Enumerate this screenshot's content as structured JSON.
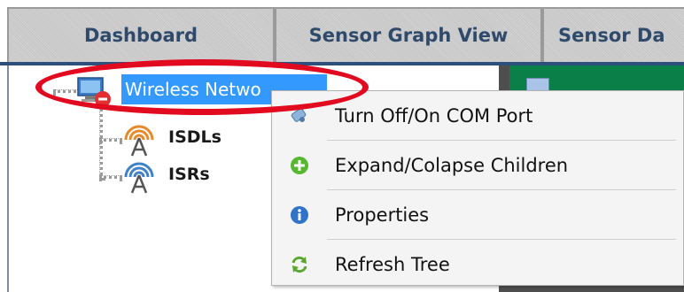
{
  "tabs": [
    {
      "label": "Dashboard"
    },
    {
      "label": "Sensor Graph View"
    },
    {
      "label": "Sensor Da"
    }
  ],
  "tree": {
    "root": {
      "label": "Wireless Netwo",
      "icon": "network-computer-icon"
    },
    "children": [
      {
        "label": "ISDLs",
        "icon": "antenna-orange-icon"
      },
      {
        "label": "ISRs",
        "icon": "antenna-blue-icon"
      }
    ]
  },
  "context_menu": {
    "items": [
      {
        "label": "Turn Off/On COM Port",
        "icon": "com-port-icon"
      },
      {
        "label": "Expand/Colapse Children",
        "icon": "plus-green-icon"
      },
      {
        "label": "Properties",
        "icon": "info-icon"
      },
      {
        "label": "Refresh Tree",
        "icon": "refresh-icon"
      }
    ]
  },
  "colors": {
    "tab_text": "#2f4a6b",
    "selection": "#3399ff",
    "annotation_red": "#e10a1e",
    "right_panel_green": "#0a7f47"
  }
}
